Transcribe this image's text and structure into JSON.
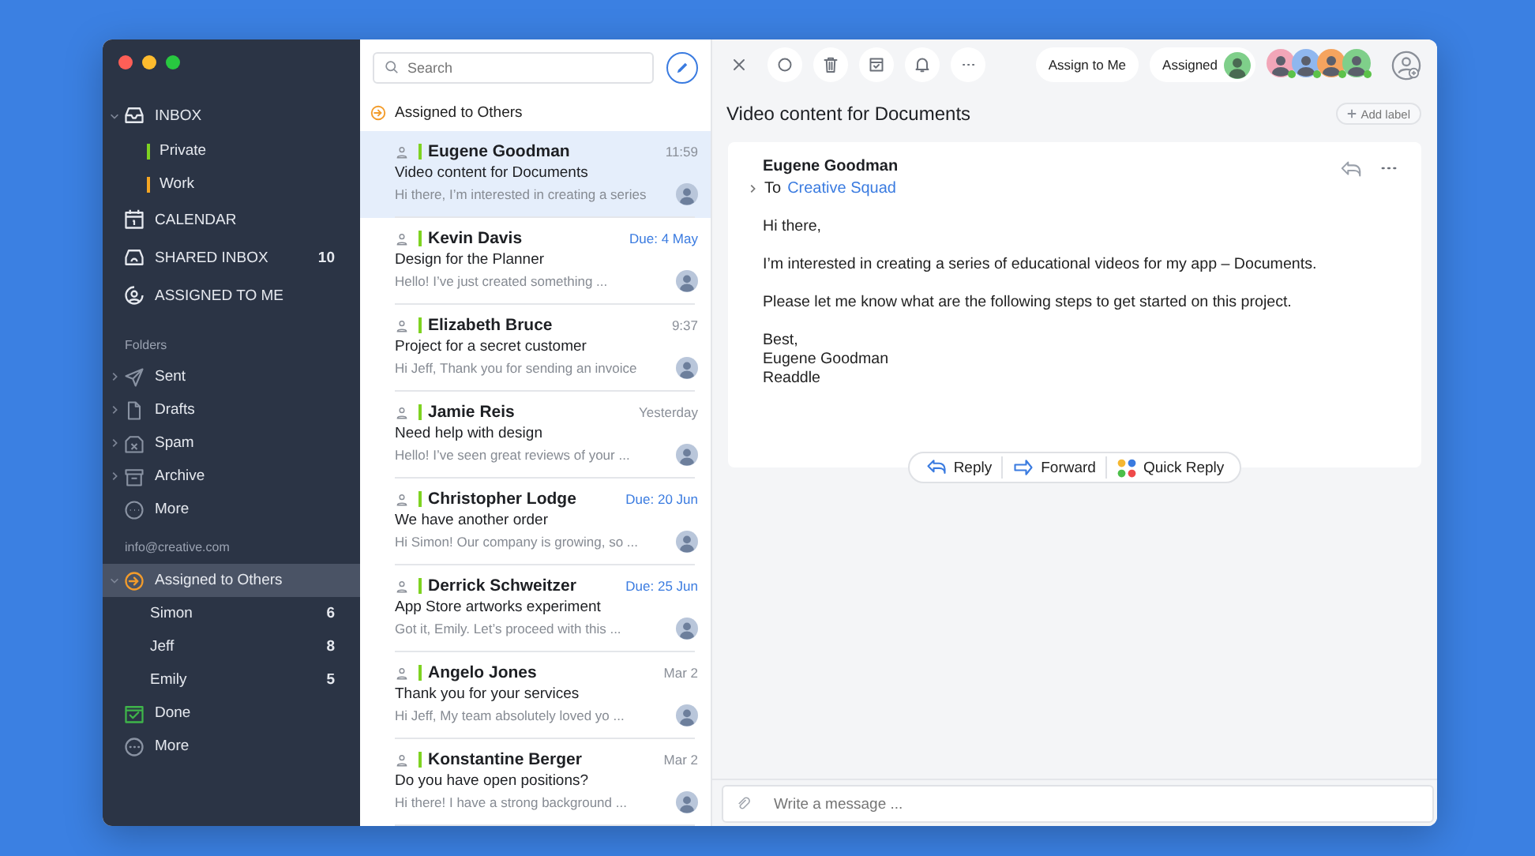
{
  "sidebar": {
    "mailboxes": [
      {
        "label": "INBOX",
        "expanded": true,
        "selected": false,
        "children": [
          {
            "label": "Private",
            "color": "#7ed321",
            "selected": false
          },
          {
            "label": "Work",
            "color": "#f5a623",
            "selected": false
          }
        ]
      },
      {
        "label": "CALENDAR",
        "selected": false
      },
      {
        "label": "SHARED INBOX",
        "count": "10",
        "selected": false
      },
      {
        "label": "ASSIGNED TO ME",
        "selected": false
      }
    ],
    "folders_heading": "Folders",
    "folders": [
      {
        "label": "Sent",
        "expanded": false,
        "selected": false
      },
      {
        "label": "Drafts",
        "expanded": false,
        "selected": false
      },
      {
        "label": "Spam",
        "expanded": false,
        "selected": false
      },
      {
        "label": "Archive",
        "expanded": false,
        "selected": false
      },
      {
        "label": "More",
        "selected": false
      }
    ],
    "account_heading": "info@creative.com",
    "account_items": [
      {
        "label": "Assigned to Others",
        "expanded": true,
        "selected": true,
        "children": [
          {
            "label": "Simon",
            "count": "6",
            "selected": false
          },
          {
            "label": "Jeff",
            "count": "8",
            "selected": false
          },
          {
            "label": "Emily",
            "count": "5",
            "selected": false
          }
        ]
      },
      {
        "label": "Done",
        "selected": false
      },
      {
        "label": "More",
        "selected": false
      }
    ]
  },
  "message_list": {
    "search": {
      "placeholder": "Search"
    },
    "heading": "Assigned to Others",
    "messages": [
      {
        "sender": "Eugene Goodman",
        "time": "11:59",
        "due": false,
        "subject": "Video content for Documents",
        "preview": "Hi there, I’m interested in creating a series",
        "selected": true
      },
      {
        "sender": "Kevin Davis",
        "time": "Due: 4 May",
        "due": true,
        "subject": "Design for the Planner",
        "preview": "Hello! I’ve just created something ...",
        "selected": false
      },
      {
        "sender": "Elizabeth Bruce",
        "time": "9:37",
        "due": false,
        "subject": "Project for a secret customer",
        "preview": "Hi Jeff, Thank you for sending an invoice",
        "selected": false
      },
      {
        "sender": "Jamie Reis",
        "time": "Yesterday",
        "due": false,
        "subject": "Need help with design",
        "preview": "Hello! I’ve seen great reviews of your ...",
        "selected": false
      },
      {
        "sender": "Christopher Lodge",
        "time": "Due: 20 Jun",
        "due": true,
        "subject": "We have another order",
        "preview": "Hi Simon! Our company is growing, so ...",
        "selected": false
      },
      {
        "sender": "Derrick Schweitzer",
        "time": "Due: 25 Jun",
        "due": true,
        "subject": "App Store artworks experiment",
        "preview": "Got it, Emily. Let’s proceed with this ...",
        "selected": false
      },
      {
        "sender": "Angelo Jones",
        "time": "Mar 2",
        "due": false,
        "subject": "Thank you for your services",
        "preview": "Hi Jeff, My team absolutely loved yo ...",
        "selected": false
      },
      {
        "sender": "Konstantine Berger",
        "time": "Mar 2",
        "due": false,
        "subject": "Do you have open positions?",
        "preview": "Hi there! I have a strong background ...",
        "selected": false
      }
    ]
  },
  "message": {
    "assign_button": "Assign to Me",
    "assigned_button": "Assigned",
    "subject": "Video content for Documents",
    "add_label": "Add label",
    "sender": "Eugene Goodman",
    "to_label": "To",
    "recipient": "Creative Squad",
    "paragraphs": [
      "Hi there,",
      "I’m interested in creating a series of educational videos for my app – Documents.",
      "Please let me know what are the following steps to get started on this project."
    ],
    "signature": [
      "Best,",
      "Eugene Goodman",
      "Readdle"
    ],
    "actions": [
      "Reply",
      "Forward",
      "Quick Reply"
    ],
    "composer": {
      "placeholder": "Write a message ..."
    }
  }
}
